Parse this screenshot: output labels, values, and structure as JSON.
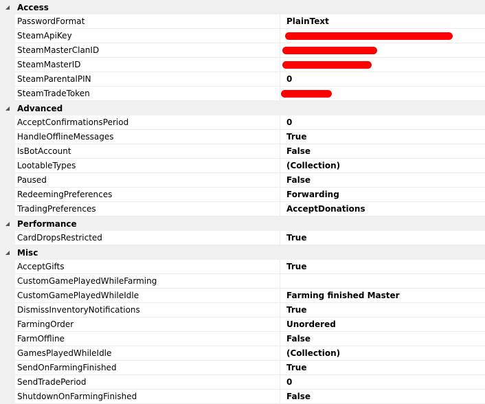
{
  "categories": [
    {
      "title": "Access",
      "rows": [
        {
          "name": "PasswordFormat",
          "value": "PlainText"
        },
        {
          "name": "SteamApiKey",
          "value": ""
        },
        {
          "name": "SteamMasterClanID",
          "value": ""
        },
        {
          "name": "SteamMasterID",
          "value": ""
        },
        {
          "name": "SteamParentalPIN",
          "value": "0"
        },
        {
          "name": "SteamTradeToken",
          "value": ""
        }
      ]
    },
    {
      "title": "Advanced",
      "rows": [
        {
          "name": "AcceptConfirmationsPeriod",
          "value": "0"
        },
        {
          "name": "HandleOfflineMessages",
          "value": "True"
        },
        {
          "name": "IsBotAccount",
          "value": "False"
        },
        {
          "name": "LootableTypes",
          "value": "(Collection)"
        },
        {
          "name": "Paused",
          "value": "False"
        },
        {
          "name": "RedeemingPreferences",
          "value": "Forwarding"
        },
        {
          "name": "TradingPreferences",
          "value": "AcceptDonations"
        }
      ]
    },
    {
      "title": "Performance",
      "rows": [
        {
          "name": "CardDropsRestricted",
          "value": "True"
        }
      ]
    },
    {
      "title": "Misc",
      "rows": [
        {
          "name": "AcceptGifts",
          "value": "True"
        },
        {
          "name": "CustomGamePlayedWhileFarming",
          "value": ""
        },
        {
          "name": "CustomGamePlayedWhileIdle",
          "value": "Farming finished Master"
        },
        {
          "name": "DismissInventoryNotifications",
          "value": "True"
        },
        {
          "name": "FarmingOrder",
          "value": "Unordered"
        },
        {
          "name": "FarmOffline",
          "value": "False"
        },
        {
          "name": "GamesPlayedWhileIdle",
          "value": "(Collection)"
        },
        {
          "name": "SendOnFarmingFinished",
          "value": "True"
        },
        {
          "name": "SendTradePeriod",
          "value": "0"
        },
        {
          "name": "ShutdownOnFarmingFinished",
          "value": "False"
        }
      ]
    }
  ],
  "icons": {
    "collapse": "collapse-triangle-icon"
  },
  "colors": {
    "redaction": "#ff0000",
    "category_background": "#f0f0f0"
  }
}
